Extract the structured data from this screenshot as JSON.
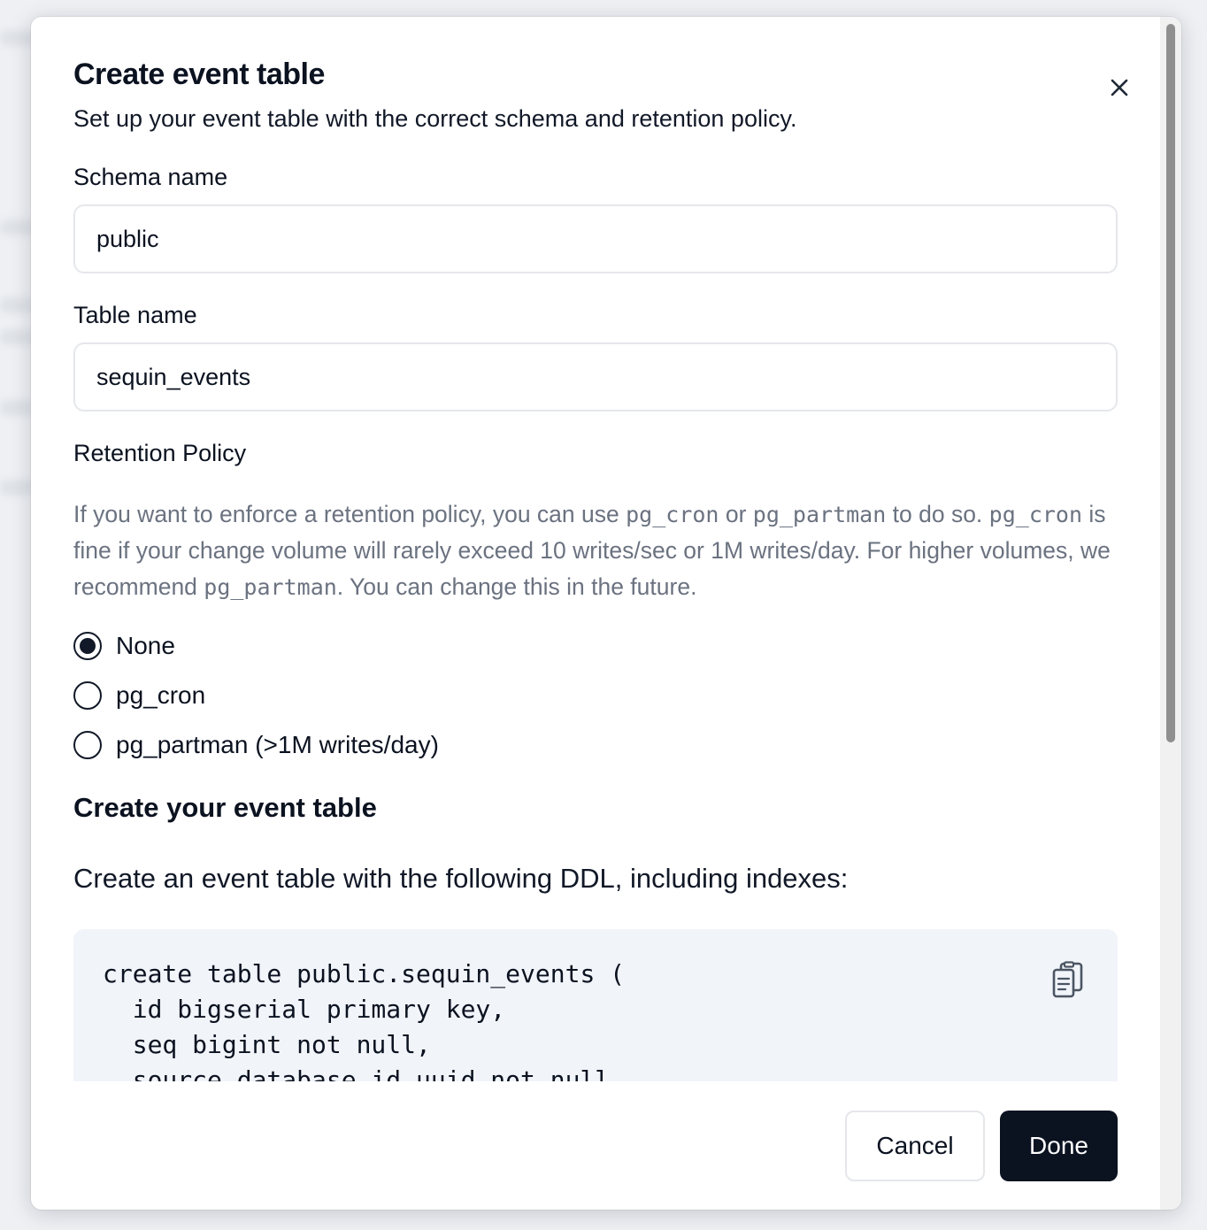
{
  "dialog": {
    "title": "Create event table",
    "subtitle": "Set up your event table with the correct schema and retention policy.",
    "close_icon": "close-icon"
  },
  "form": {
    "schema_label": "Schema name",
    "schema_value": "public",
    "table_label": "Table name",
    "table_value": "sequin_events",
    "retention_label": "Retention Policy",
    "help": {
      "p1": "If you want to enforce a retention policy, you can use ",
      "c1": "pg_cron",
      "p2": " or ",
      "c2": "pg_partman",
      "p3": " to do so. ",
      "c3": "pg_cron",
      "p4": " is fine if your change volume will rarely exceed 10 writes/sec or 1M writes/day. For higher volumes, we recommend ",
      "c4": "pg_partman",
      "p5": ". You can change this in the future."
    },
    "options": [
      {
        "label": "None",
        "selected": true
      },
      {
        "label": "pg_cron",
        "selected": false
      },
      {
        "label": "pg_partman (>1M writes/day)",
        "selected": false
      }
    ]
  },
  "ddl": {
    "section_title": "Create your event table",
    "intro": "Create an event table with the following DDL, including indexes:",
    "lines": [
      "create table public.sequin_events (",
      "  id bigserial primary key,",
      "  seq bigint not null,",
      "  source_database_id uuid not null,"
    ],
    "copy_icon": "clipboard-copy-icon"
  },
  "footer": {
    "cancel_label": "Cancel",
    "done_label": "Done"
  }
}
